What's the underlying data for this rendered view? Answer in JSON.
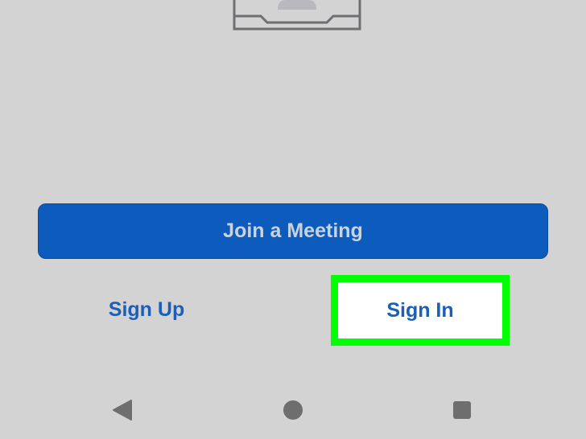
{
  "actions": {
    "join_meeting_label": "Join a Meeting",
    "sign_up_label": "Sign Up",
    "sign_in_label": "Sign In"
  },
  "icons": {
    "illustration": "device-illustration-icon",
    "back": "back-triangle-icon",
    "home": "home-circle-icon",
    "recents": "recents-square-icon"
  },
  "colors": {
    "background": "#d3d3d3",
    "primary_button": "#0d5cbd",
    "primary_button_text": "#c9d3df",
    "link_text": "#1c5fb8",
    "highlight": "#00ff00",
    "nav_icon": "#6e6e6e"
  }
}
